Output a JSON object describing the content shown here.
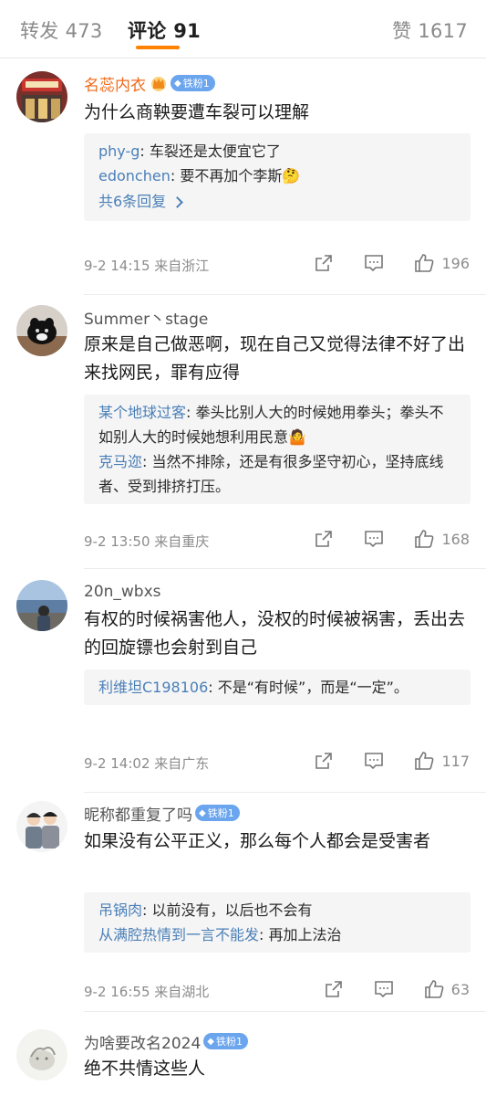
{
  "tabs": {
    "repost": "转发 473",
    "comment": "评论 91",
    "like": "赞 1617"
  },
  "colors": {
    "accent": "#ff8200",
    "link": "#4a7fb8",
    "vip_name": "#ef6a1a",
    "badge": "#6aa5ee",
    "reply_bg": "#f5f5f5"
  },
  "comments": [
    {
      "username": "名蕊内衣",
      "badge": "铁粉1",
      "text": "为什么商鞅要遭车裂可以理解",
      "replies": [
        {
          "name": "phy-g",
          "text": ": 车裂还是太便宜它了"
        },
        {
          "name": "edonchen",
          "text": ": 要不再加个李斯🤔"
        }
      ],
      "more": "共6条回复",
      "meta": "9-2 14:15  来自浙江",
      "likes": "196"
    },
    {
      "username": "Summer丶stage",
      "text": "原来是自己做恶啊，现在自己又觉得法律不好了出来找网民，罪有应得",
      "replies": [
        {
          "name": "某个地球过客",
          "text": ": 拳头比别人大的时候她用拳头；拳头不如别人大的时候她想利用民意🤷"
        },
        {
          "name": "克马迩",
          "text": ": 当然不排除，还是有很多坚守初心，坚持底线者、受到排挤打压。"
        }
      ],
      "meta": "9-2 13:50  来自重庆",
      "likes": "168"
    },
    {
      "username": "20n_wbxs",
      "text": "有权的时候祸害他人，没权的时候被祸害，丢出去的回旋镖也会射到自己",
      "replies": [
        {
          "name": "利维坦C198106",
          "text": ": 不是“有时候”，而是“一定”。"
        }
      ],
      "meta": "9-2 14:02  来自广东",
      "likes": "117"
    },
    {
      "username": "昵称都重复了吗",
      "badge": "铁粉1",
      "text": "如果没有公平正义，那么每个人都会是受害者",
      "replies": [
        {
          "name": "吊锅肉",
          "text": ": 以前没有，以后也不会有"
        },
        {
          "name": "从满腔热情到一言不能发",
          "text": ": 再加上法治"
        }
      ],
      "meta": "9-2 16:55  来自湖北",
      "likes": "63"
    },
    {
      "username": "为啥要改名2024",
      "badge": "铁粉1",
      "text": "绝不共情这些人"
    }
  ]
}
